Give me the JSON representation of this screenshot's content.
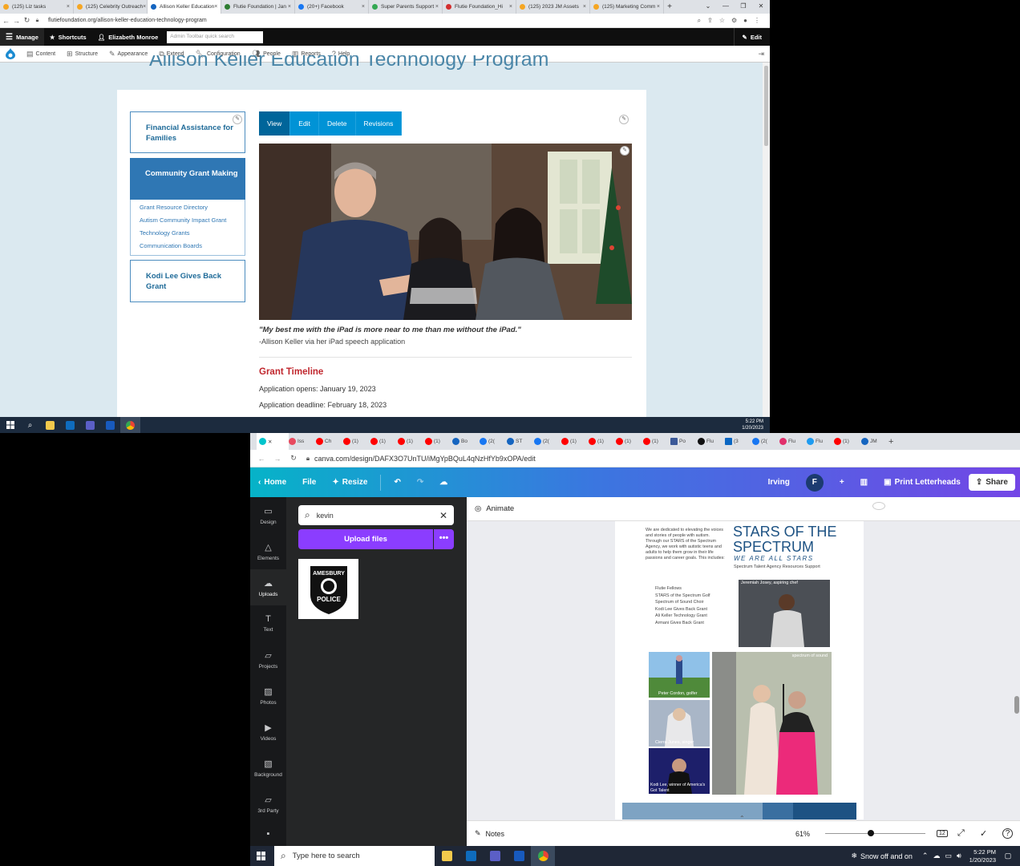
{
  "top_window": {
    "tabs": [
      {
        "label": "(125) Liz tasks",
        "color": "#f5a623"
      },
      {
        "label": "(125) Celebrity Outreach",
        "color": "#f5a623"
      },
      {
        "label": "Allison Keller Education",
        "color": "#1565c0",
        "active": true
      },
      {
        "label": "Flutie Foundation | Jan",
        "color": "#2e7d32"
      },
      {
        "label": "(20+) Facebook",
        "color": "#1877f2"
      },
      {
        "label": "Super Parents Support",
        "color": "#34a853"
      },
      {
        "label": "Flutie Foundation_Hi",
        "color": "#d32f2f"
      },
      {
        "label": "(125) 2023 JM Assets",
        "color": "#f5a623"
      },
      {
        "label": "(125) Marketing Comm",
        "color": "#f5a623"
      }
    ],
    "url": "flutiefoundation.org/allison-keller-education-technology-program",
    "admin_toolbar": {
      "manage": "Manage",
      "shortcuts": "Shortcuts",
      "user": "Elizabeth Monroe",
      "search_placeholder": "Admin Toolbar quick search",
      "edit": "Edit"
    },
    "tray_items": [
      "Content",
      "Structure",
      "Appearance",
      "Extend",
      "Configuration",
      "People",
      "Reports",
      "Help"
    ],
    "page_title": "Allison Keller Education Technology Program",
    "sidebar": {
      "financial": "Financial Assistance for Families",
      "community": "Community Grant Making",
      "sub_links": [
        "Grant Resource Directory",
        "Autism Community Impact Grant",
        "Technology Grants",
        "Communication Boards"
      ],
      "kodi": "Kodi Lee Gives Back Grant"
    },
    "local_tabs": [
      "View",
      "Edit",
      "Delete",
      "Revisions"
    ],
    "quote": "\"My best me with the iPad is more near to me than me without the iPad.\"",
    "quote_by": "-Allison Keller via her iPad speech application",
    "grant_timeline": "Grant Timeline",
    "app_opens": "Application opens: January 19, 2023",
    "app_deadline": "Application deadline: February 18, 2023",
    "clock_time": "5:22 PM",
    "clock_date": "1/20/2023"
  },
  "bottom_window": {
    "tabs": [
      "Iss",
      "Ch",
      "(1)",
      "(1)",
      "(1)",
      "(1)",
      "Bo",
      "(2(",
      "ST",
      "(2(",
      "(1)",
      "(1)",
      "(1)",
      "(1)",
      "Po",
      "Flu",
      "(3",
      "(2(",
      "Flu",
      "Flu",
      "(1)",
      "JM"
    ],
    "url": "canva.com/design/DAFX3O7UnTU/iMgYpBQuL4qNzHfYb9xOPA/edit",
    "header": {
      "home": "Home",
      "file": "File",
      "resize": "Resize",
      "team": "Irving",
      "avatar": "F",
      "print": "Print Letterheads",
      "share": "Share"
    },
    "rail": [
      "Design",
      "Elements",
      "Uploads",
      "Text",
      "Projects",
      "Photos",
      "Videos",
      "Background",
      "3rd Party"
    ],
    "search_value": "kevin",
    "upload_button": "Upload files",
    "thumb_text": [
      "AMESBURY",
      "POLICE"
    ],
    "animate": "Animate",
    "design": {
      "intro": "We are dedicated to elevating the voices and stories of people with autism. Through our STARS of the Spectrum Agency, we work with autistic teens and adults to help them grow in their life passions and career goals. This includes:",
      "list": [
        "Flutie Fellows",
        "STARS of the Spectrum Golf",
        "Spectrum of Sound Choir",
        "Kodi Lee Gives Back Grant",
        "Ali Keller Technology Grant",
        "Armani Gives Back Grant"
      ],
      "title1": "STARS OF THE",
      "title2": "SPECTRUM",
      "tagline": "WE ARE ALL STARS",
      "acronym": "Spectrum Talent Agency Resources Support",
      "caption_jeremiah": "Jeremiah Josey, aspiring chef",
      "caption_sound": "spectrum of sound",
      "caption_peter": "Peter Cordon, golfer",
      "caption_cierra": "Cierra Junes, singer",
      "caption_kodi": "Kodi Lee, winner of America's Got Talent"
    },
    "notes": "Notes",
    "zoom": "61%",
    "pages": "12"
  },
  "taskbar": {
    "search_placeholder": "Type here to search",
    "weather": "Snow off and on",
    "time": "5:22 PM",
    "date": "1/20/2023"
  },
  "colors": {
    "drupal_blue": "#2f77b4",
    "canva_purple": "#8b3dff",
    "timeline_red": "#c0262d"
  }
}
